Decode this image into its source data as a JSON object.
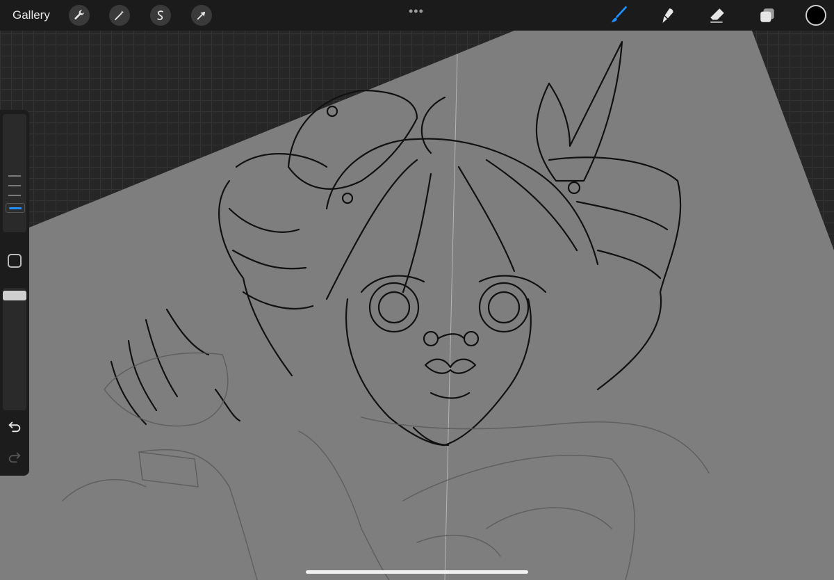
{
  "topbar": {
    "gallery_label": "Gallery",
    "left_tools": [
      "wrench-icon",
      "magic-wand-icon",
      "selection-icon",
      "transform-arrow-icon"
    ],
    "center_menu": "•••",
    "right_tools": [
      "brush-icon",
      "smudge-icon",
      "eraser-icon",
      "layers-icon"
    ],
    "current_color": "#000000",
    "accent_color": "#1e90ff"
  },
  "sidebar": {
    "brush_size_thumb_color": "#1e90ff",
    "modify_button": "square-icon",
    "undo": "undo-icon",
    "redo": "redo-icon"
  }
}
